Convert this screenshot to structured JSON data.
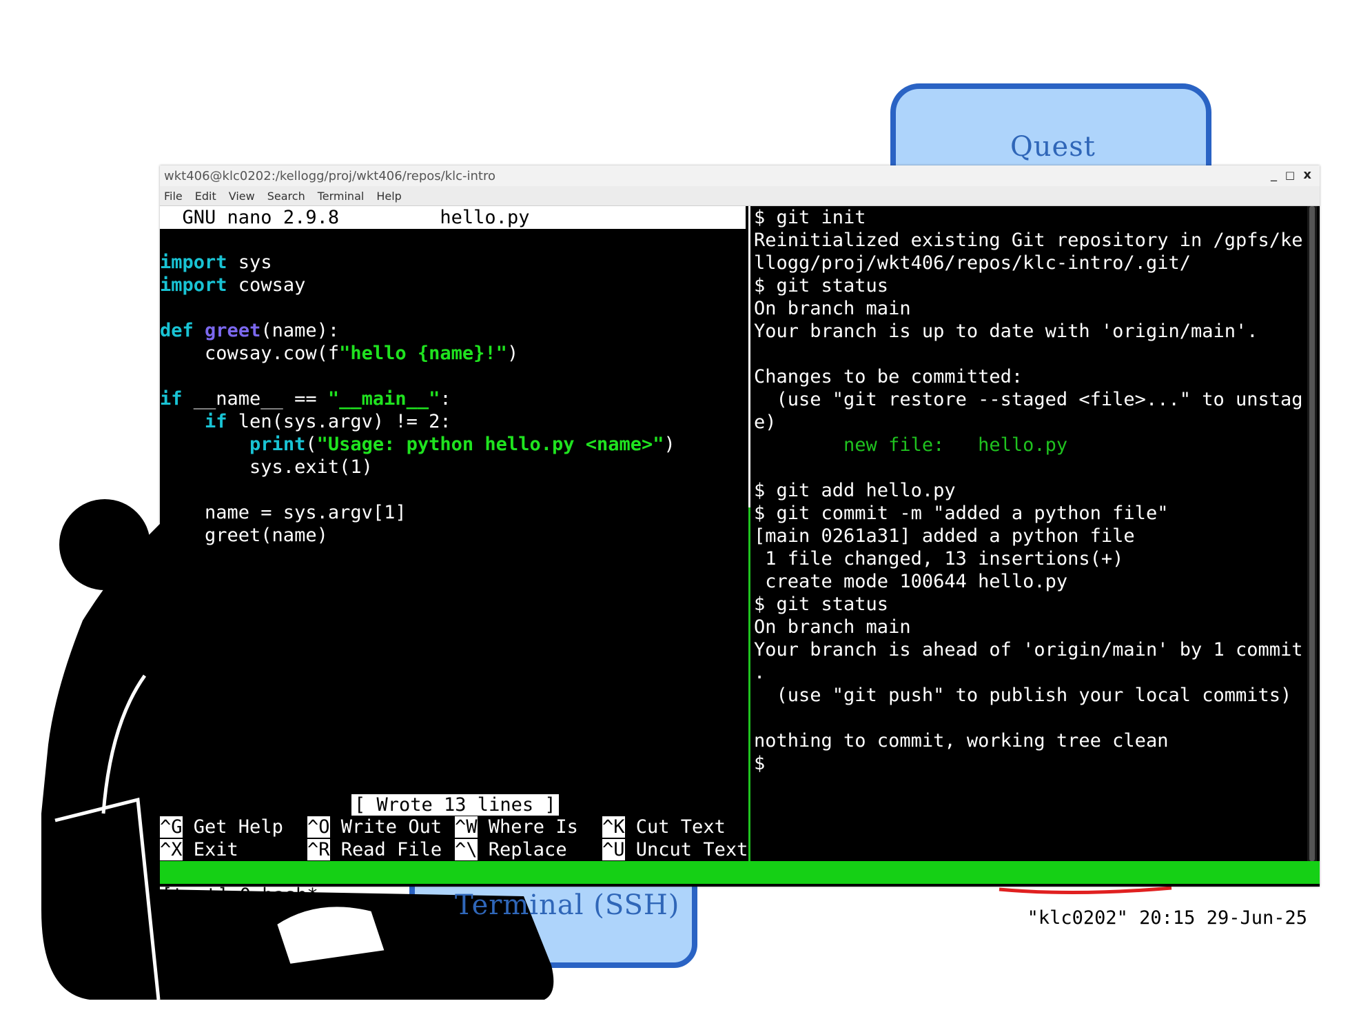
{
  "labels": {
    "quest": "Quest",
    "terminal_ssh": "Terminal (SSH)"
  },
  "window": {
    "title": "wkt406@klc0202:/kellogg/proj/wkt406/repos/klc-intro",
    "menu": [
      "File",
      "Edit",
      "View",
      "Search",
      "Terminal",
      "Help"
    ]
  },
  "nano": {
    "header_app": "GNU nano 2.9.8",
    "header_file": "hello.py",
    "status": "[ Wrote 13 lines ]",
    "shortcuts": [
      {
        "key": "^G",
        "label": "Get Help"
      },
      {
        "key": "^O",
        "label": "Write Out"
      },
      {
        "key": "^W",
        "label": "Where Is"
      },
      {
        "key": "^K",
        "label": "Cut Text"
      },
      {
        "key": "^X",
        "label": "Exit"
      },
      {
        "key": "^R",
        "label": "Read File"
      },
      {
        "key": "^\\",
        "label": "Replace"
      },
      {
        "key": "^U",
        "label": "Uncut Text"
      }
    ]
  },
  "code": {
    "l1_kw": "import",
    "l1_rest": " sys",
    "l2_kw": "import",
    "l2_rest": " cowsay",
    "l3_kw": "def",
    "l3_fn": "greet",
    "l3_rest": "(name):",
    "l4_a": "    cowsay.cow(f",
    "l4_str": "\"hello {name}!\"",
    "l4_b": ")",
    "l5_kw": "if",
    "l5_a": " __name__ == ",
    "l5_str": "\"__main__\"",
    "l5_b": ":",
    "l6_kw": "if",
    "l6_rest": " len(sys.argv) != 2:",
    "l7_kw": "print",
    "l7_a": "(",
    "l7_str": "\"Usage: python hello.py <name>\"",
    "l7_b": ")",
    "l8": "        sys.exit(1)",
    "l9": "    name = sys.argv[1]",
    "l10": "    greet(name)"
  },
  "shell": {
    "lines": [
      "$ git init",
      "Reinitialized existing Git repository in /gpfs/ke",
      "llogg/proj/wkt406/repos/klc-intro/.git/",
      "$ git status",
      "On branch main",
      "Your branch is up to date with 'origin/main'.",
      "",
      "Changes to be committed:",
      "  (use \"git restore --staged <file>...\" to unstag",
      "e)",
      "        new file:   hello.py",
      "",
      "$ git add hello.py",
      "$ git commit -m \"added a python file\"",
      "[main 0261a31] added a python file",
      " 1 file changed, 13 insertions(+)",
      " create mode 100644 hello.py",
      "$ git status",
      "On branch main",
      "Your branch is ahead of 'origin/main' by 1 commit",
      ".",
      "  (use \"git push\" to publish your local commits)",
      "",
      "nothing to commit, working tree clean",
      "$"
    ]
  },
  "tmux": {
    "left": "[test] 0:bash*",
    "right": "\"klc0202\" 20:15 29-Jun-25"
  },
  "colors": {
    "keyword": "#19c3d4",
    "function": "#7b68ee",
    "string": "#1fe31f",
    "status_bar": "#15d015",
    "sketch_blue": "#2f66b8"
  }
}
